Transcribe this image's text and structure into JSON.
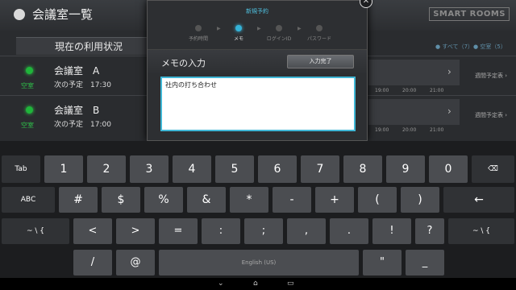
{
  "app": {
    "title": "会議室一覧",
    "brand": "SMART ROOMS",
    "status_header": "現在の利用状況",
    "filter_text": "● すべて（7）● 空室（5）"
  },
  "rooms": [
    {
      "name": "会議室　A",
      "status": "空室",
      "next": "次の予定　17:30",
      "ticks": [
        "19:00",
        "20:00",
        "21:00"
      ],
      "week_link": "週間予定表 ›"
    },
    {
      "name": "会議室　B",
      "status": "空室",
      "next": "次の予定　17:00",
      "ticks": [
        "19:00",
        "20:00",
        "21:00"
      ],
      "week_link": "週間予定表 ›"
    }
  ],
  "dialog": {
    "title": "新規予約",
    "steps": [
      {
        "label": "予約時間",
        "active": false
      },
      {
        "label": "メモ",
        "active": true
      },
      {
        "label": "ログインID",
        "active": false
      },
      {
        "label": "パスワード",
        "active": false
      }
    ],
    "memo_label": "メモの入力",
    "done_button": "入力完了",
    "memo_value": "社内の打ち合わせ",
    "close_icon": "close-icon"
  },
  "keyboard": {
    "row1": [
      "Tab",
      "1",
      "2",
      "3",
      "4",
      "5",
      "6",
      "7",
      "8",
      "9",
      "0",
      "⌫"
    ],
    "row2": [
      "ABC",
      "#",
      "$",
      "%",
      "&",
      "*",
      "-",
      "+",
      "(",
      ")",
      "←"
    ],
    "row3": [
      "~ \\ {",
      "<",
      ">",
      "=",
      ":",
      ";",
      ",",
      ".",
      "!",
      "?",
      "~ \\ {"
    ],
    "row4": [
      "/",
      "@",
      "English (US)",
      "\"",
      "_"
    ]
  },
  "navbar": {
    "icons": [
      "back-icon",
      "home-icon",
      "recents-icon"
    ]
  }
}
